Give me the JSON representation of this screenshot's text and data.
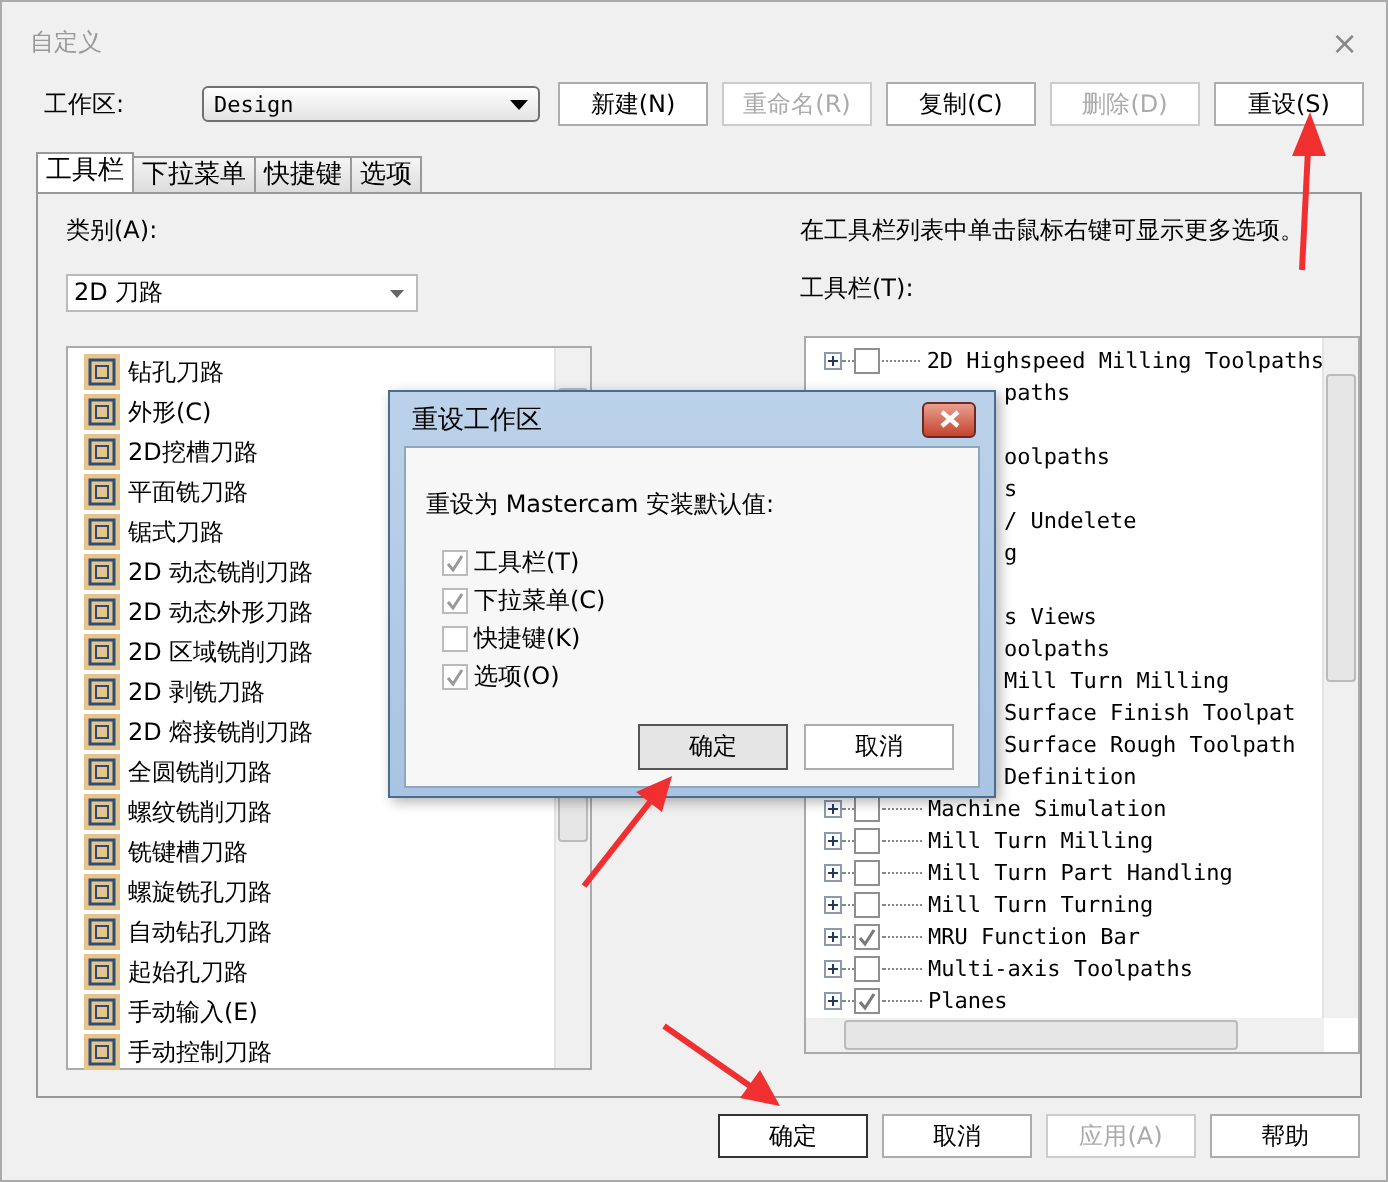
{
  "window": {
    "title": "自定义",
    "close": "×"
  },
  "workspace": {
    "label": "工作区:",
    "value": "Design"
  },
  "buttons": [
    {
      "label": "新建(N)",
      "disabled": false
    },
    {
      "label": "重命名(R)",
      "disabled": true
    },
    {
      "label": "复制(C)",
      "disabled": false
    },
    {
      "label": "删除(D)",
      "disabled": true
    },
    {
      "label": "重设(S)",
      "disabled": false
    }
  ],
  "tabs": [
    {
      "label": "工具栏",
      "selected": true
    },
    {
      "label": "下拉菜单",
      "selected": false
    },
    {
      "label": "快捷键",
      "selected": false
    },
    {
      "label": "选项",
      "selected": false
    }
  ],
  "category": {
    "label": "类别(A):",
    "value": "2D 刀路"
  },
  "hint": "在工具栏列表中单击鼠标右键可显示更多选项。",
  "toolbar_label": "工具栏(T):",
  "commands": [
    {
      "label": "钻孔刀路"
    },
    {
      "label": "外形(C)"
    },
    {
      "label": "2D挖槽刀路"
    },
    {
      "label": "平面铣刀路"
    },
    {
      "label": "锯式刀路"
    },
    {
      "label": "2D 动态铣削刀路"
    },
    {
      "label": "2D 动态外形刀路"
    },
    {
      "label": "2D 区域铣削刀路"
    },
    {
      "label": "2D 剥铣刀路"
    },
    {
      "label": "2D 熔接铣削刀路"
    },
    {
      "label": "全圆铣削刀路"
    },
    {
      "label": "螺纹铣削刀路"
    },
    {
      "label": "铣键槽刀路"
    },
    {
      "label": "螺旋铣孔刀路"
    },
    {
      "label": "自动钻孔刀路"
    },
    {
      "label": "起始孔刀路"
    },
    {
      "label": "手动输入(E)"
    },
    {
      "label": "手动控制刀路"
    }
  ],
  "toolbars": [
    {
      "kind": "item",
      "label": "2D Highspeed Milling Toolpaths",
      "checked": false
    },
    {
      "kind": "covered",
      "label": "paths"
    },
    {
      "kind": "blank"
    },
    {
      "kind": "covered",
      "label": "oolpaths"
    },
    {
      "kind": "covered",
      "label": "s"
    },
    {
      "kind": "covered",
      "label": "/ Undelete"
    },
    {
      "kind": "covered",
      "label": "g"
    },
    {
      "kind": "blank"
    },
    {
      "kind": "covered",
      "label": "s Views"
    },
    {
      "kind": "covered",
      "label": "oolpaths"
    },
    {
      "kind": "covered",
      "label": "Mill Turn Milling"
    },
    {
      "kind": "covered",
      "label": "Surface Finish Toolpat"
    },
    {
      "kind": "covered",
      "label": "Surface Rough Toolpath"
    },
    {
      "kind": "covered",
      "label": "Definition"
    },
    {
      "kind": "item",
      "label": "Machine Simulation",
      "checked": false
    },
    {
      "kind": "item",
      "label": "Mill Turn Milling",
      "checked": false
    },
    {
      "kind": "item",
      "label": "Mill Turn Part Handling",
      "checked": false
    },
    {
      "kind": "item",
      "label": "Mill Turn Turning",
      "checked": false
    },
    {
      "kind": "item",
      "label": "MRU Function Bar",
      "checked": true
    },
    {
      "kind": "item",
      "label": "Multi-axis Toolpaths",
      "checked": false
    },
    {
      "kind": "item",
      "label": "Planes",
      "checked": true
    }
  ],
  "footer_buttons": [
    {
      "label": "确定",
      "disabled": false,
      "selected": true
    },
    {
      "label": "取消",
      "disabled": false,
      "selected": false
    },
    {
      "label": "应用(A)",
      "disabled": true,
      "selected": false
    },
    {
      "label": "帮助",
      "disabled": false,
      "selected": false
    }
  ],
  "dialog": {
    "title": "重设工作区",
    "message": "重设为 Mastercam 安装默认值:",
    "options": [
      {
        "label": "工具栏(T)",
        "checked": true
      },
      {
        "label": "下拉菜单(C)",
        "checked": true
      },
      {
        "label": "快捷键(K)",
        "checked": false
      },
      {
        "label": "选项(O)",
        "checked": true
      }
    ],
    "buttons": [
      {
        "label": "确定",
        "selected": true
      },
      {
        "label": "取消",
        "selected": false
      }
    ]
  }
}
